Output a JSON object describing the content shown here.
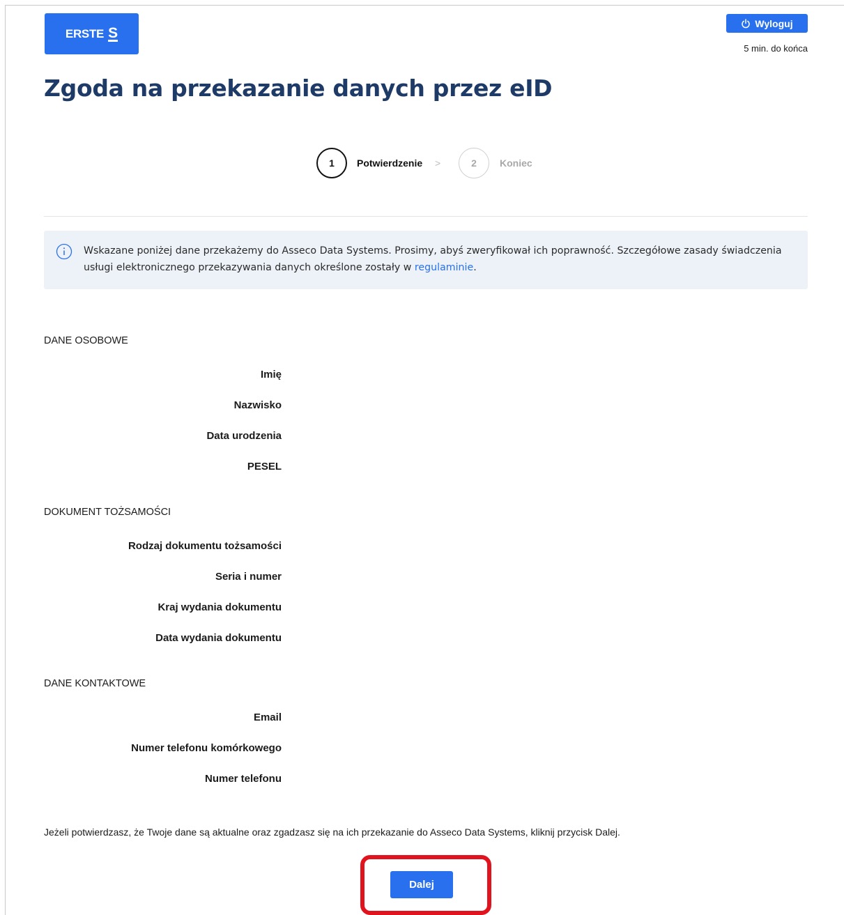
{
  "header": {
    "logo_text": "ERSTE",
    "logout_label": "Wyloguj",
    "session_timer": "5  min. do końca"
  },
  "page": {
    "title": "Zgoda na przekazanie danych przez eID"
  },
  "stepper": {
    "steps": [
      {
        "number": "1",
        "label": "Potwierdzenie",
        "state": "active"
      },
      {
        "number": "2",
        "label": "Koniec",
        "state": "inactive"
      }
    ],
    "separator": ">"
  },
  "info": {
    "text": "Wskazane poniżej dane przekażemy do Asseco Data Systems. Prosimy, abyś zweryfikował ich poprawność. Szczegółowe zasady świadczenia usługi elektronicznego przekazywania danych określone zostały w",
    "link_label": "regulaminie",
    "suffix": "."
  },
  "sections": [
    {
      "title": "DANE OSOBOWE",
      "fields": [
        "Imię",
        "Nazwisko",
        "Data urodzenia",
        "PESEL"
      ]
    },
    {
      "title": "DOKUMENT TOŻSAMOŚCI",
      "fields": [
        "Rodzaj dokumentu tożsamości",
        "Seria i numer",
        "Kraj wydania dokumentu",
        "Data wydania dokumentu"
      ]
    },
    {
      "title": "DANE KONTAKTOWE",
      "fields": [
        "Email",
        "Numer telefonu komórkowego",
        "Numer telefonu"
      ]
    }
  ],
  "confirm_text": "Jeżeli potwierdzasz, że Twoje dane są aktualne oraz zgadzasz się na ich przekazanie do Asseco Data Systems, kliknij przycisk Dalej.",
  "next_button_label": "Dalej",
  "colors": {
    "brand": "#2870ed",
    "title": "#1e3a67",
    "info_bg": "#edf2f8",
    "highlight": "#e0141e"
  }
}
